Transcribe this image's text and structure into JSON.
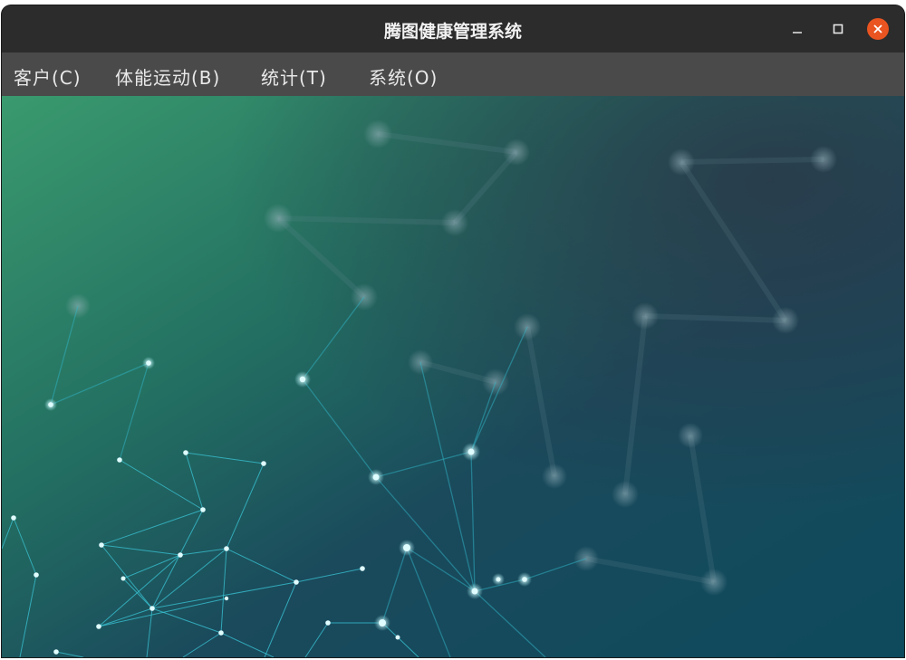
{
  "window": {
    "title": "腾图健康管理系统",
    "controls": {
      "minimize_icon": "minimize-icon",
      "maximize_icon": "maximize-icon",
      "close_icon": "close-icon",
      "close_color": "#e95420"
    }
  },
  "menu": {
    "items": [
      {
        "label": "客户(C)"
      },
      {
        "label": "体能运动(B)"
      },
      {
        "label": "统计(T)"
      },
      {
        "label": "系统(O)"
      }
    ]
  },
  "background": {
    "description_icon": "network-background",
    "colors": {
      "green": "#3a9a6e",
      "navy": "#2a3a4a",
      "teal": "#0d4a5c",
      "node": "#bff6ff",
      "line": "#39c6d6"
    }
  }
}
